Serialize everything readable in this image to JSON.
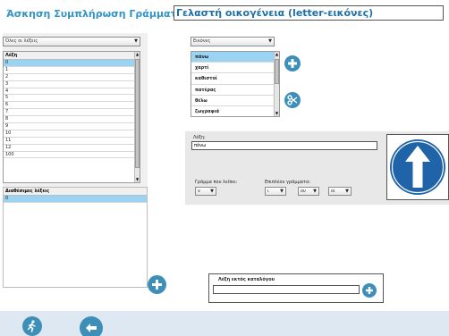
{
  "header": {
    "label": "Άσκηση Συμπλήρωση Γράμματος:",
    "title_value": "Γελαστή οικογένεια (letter-εικόνες)"
  },
  "left": {
    "filter_select": "Όλες οι λέξεις",
    "words_header": "Λέξη",
    "words": [
      "0",
      "1",
      "2",
      "3",
      "4",
      "5",
      "6",
      "7",
      "8",
      "9",
      "10",
      "11",
      "12",
      "100"
    ],
    "available_header": "Διαθέσιμες λέξεις",
    "available": [
      "0"
    ]
  },
  "images": {
    "select": "Εικόνες",
    "words": [
      "πάνω",
      "χαρτί",
      "καθιστοί",
      "πατέρας",
      "θέλω",
      "ζωγραφιά"
    ]
  },
  "detail": {
    "word_label": "Λέξη:",
    "word_value": "πάνω",
    "missing_label": "Γράμμα που λείπει:",
    "missing_value": "ν",
    "extra_label": "Επιπλέον γράμματα:",
    "extra_values": [
      "ι",
      "ου",
      "οι"
    ]
  },
  "outside": {
    "label": "Λέξη εκτός καταλόγου",
    "value": ""
  },
  "icons": {
    "arrow_sign": "up-arrow-sign",
    "accent": "#3d8fb8",
    "sign_blue": "#1f63a8"
  }
}
